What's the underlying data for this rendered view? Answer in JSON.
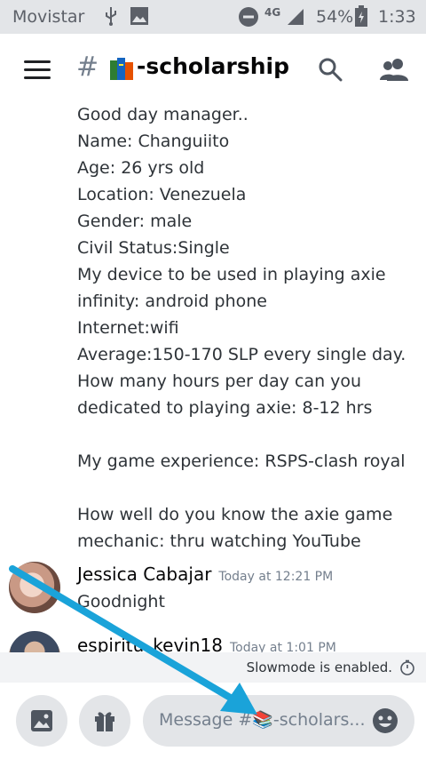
{
  "status_bar": {
    "carrier": "Movistar",
    "network": "4G",
    "battery": "54%",
    "time": "1:33"
  },
  "header": {
    "hash": "#",
    "channel_name": "-scholarship"
  },
  "messages": {
    "previous_message_lines": [
      "Good day manager..",
      "Name: Changuiito",
      "Age: 26 yrs old",
      "Location: Venezuela",
      "Gender: male",
      "Civil Status:Single",
      "My device to be used in playing axie",
      "infinity: android phone",
      "Internet:wifi",
      "Average:150-170 SLP every single day.",
      "How many hours per day can you",
      "dedicated to playing axie: 8-12 hrs",
      "",
      "My game experience: RSPS-clash royal",
      "",
      "How well do you know the axie game",
      "mechanic: thru watching YouTube"
    ],
    "items": [
      {
        "author": "Jessica Cabajar",
        "timestamp": "Today at 12:21 PM",
        "text": "Goodnight"
      },
      {
        "author": "espiritu_kevin18",
        "timestamp": "Today at 1:01 PM"
      }
    ]
  },
  "slowmode": {
    "text": "Slowmode is enabled."
  },
  "composer": {
    "placeholder": "Message #📚-scholars..."
  },
  "colors": {
    "accent": "#1aa3d9",
    "status_bar_bg": "#e3e5e8",
    "input_bg": "#e3e5e8"
  }
}
